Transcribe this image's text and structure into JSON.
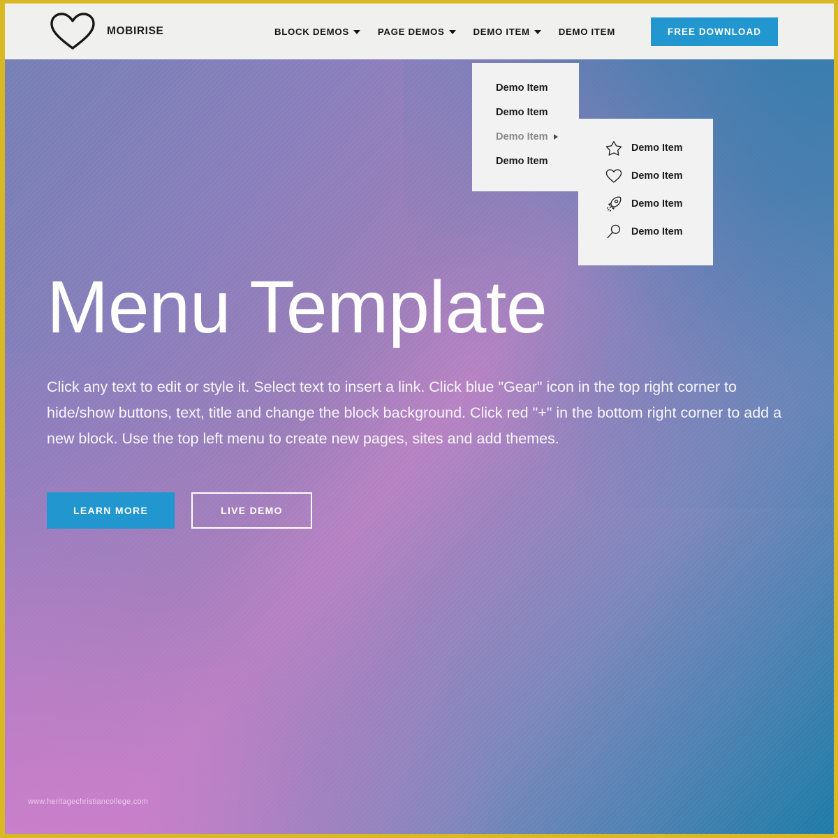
{
  "header": {
    "brand_name": "MOBIRISE",
    "logo_icon": "heart-icon",
    "nav": [
      {
        "label": "BLOCK DEMOS",
        "has_caret": true
      },
      {
        "label": "PAGE DEMOS",
        "has_caret": true
      },
      {
        "label": "DEMO ITEM",
        "has_caret": true
      },
      {
        "label": "DEMO ITEM",
        "has_caret": false
      }
    ],
    "download_button": "FREE DOWNLOAD"
  },
  "dropdown": {
    "items": [
      {
        "label": "Demo Item",
        "has_submenu": false,
        "active": false
      },
      {
        "label": "Demo Item",
        "has_submenu": false,
        "active": false
      },
      {
        "label": "Demo Item",
        "has_submenu": true,
        "active": true
      },
      {
        "label": "Demo Item",
        "has_submenu": false,
        "active": false
      }
    ]
  },
  "submenu": {
    "items": [
      {
        "label": "Demo Item",
        "icon": "star-icon"
      },
      {
        "label": "Demo Item",
        "icon": "heart-icon"
      },
      {
        "label": "Demo Item",
        "icon": "rocket-icon"
      },
      {
        "label": "Demo Item",
        "icon": "magnifier-icon"
      }
    ]
  },
  "hero": {
    "title": "Menu Template",
    "text": "Click any text to edit or style it. Select text to insert a link. Click blue \"Gear\" icon in the top right corner to hide/show buttons, text, title and change the block background. Click red \"+\" in the bottom right corner to add a new block. Use the top left menu to create new pages, sites and add themes.",
    "primary_button": "LEARN MORE",
    "secondary_button": "LIVE DEMO"
  },
  "watermark": "www.heritagechristiancollege.com",
  "colors": {
    "accent_blue": "#2196cf",
    "frame_border": "#d8b823",
    "header_bg": "#f0f0ef",
    "dropdown_bg": "#f2f2f2",
    "gradient_top_left": "#7781b6",
    "gradient_top_right": "#1d7ca8",
    "gradient_bottom_left": "#d880d0",
    "gradient_center": "#8d7fbe"
  }
}
